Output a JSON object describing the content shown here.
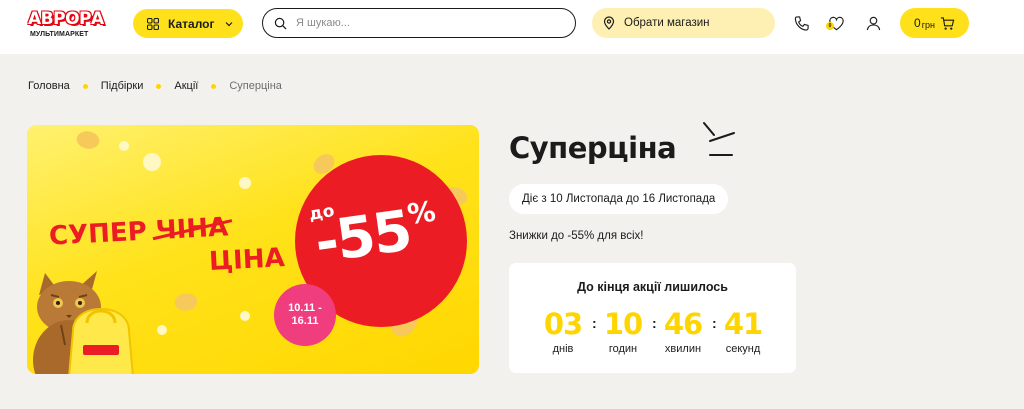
{
  "header": {
    "logo": {
      "name": "АВРОРА",
      "subtitle": "МУЛЬТИМАРКЕТ"
    },
    "catalog_label": "Каталог",
    "search_placeholder": "Я шукаю...",
    "store_label": "Обрати магазин",
    "favorites_count": "0",
    "cart": {
      "amount": "0",
      "currency": "грн"
    },
    "colors": {
      "accent": "#ffe11b",
      "store_bg": "#fdf0b2"
    }
  },
  "breadcrumb": [
    "Головна",
    "Підбірки",
    "Акції",
    "Суперціна"
  ],
  "banner": {
    "line1": "СУПЕР",
    "crossed": "ЧІНА",
    "line2": "ЦІНА",
    "prefix": "до",
    "discount": "-55",
    "percent": "%",
    "date_from": "10.11 -",
    "date_to": "16.11",
    "colors": {
      "red": "#ec1c24",
      "pink": "#ef3d7d",
      "yellow": "#ffe21a"
    }
  },
  "promo": {
    "title": "Суперціна",
    "period": "Діє з 10 Листопада до 16 Листопада",
    "description": "Знижки до -55% для всіх!"
  },
  "countdown": {
    "title": "До кінця акції лишилось",
    "units": [
      {
        "value": "03",
        "label": "днів"
      },
      {
        "value": "10",
        "label": "годин"
      },
      {
        "value": "46",
        "label": "хвилин"
      },
      {
        "value": "41",
        "label": "секунд"
      }
    ],
    "separator": ":"
  }
}
